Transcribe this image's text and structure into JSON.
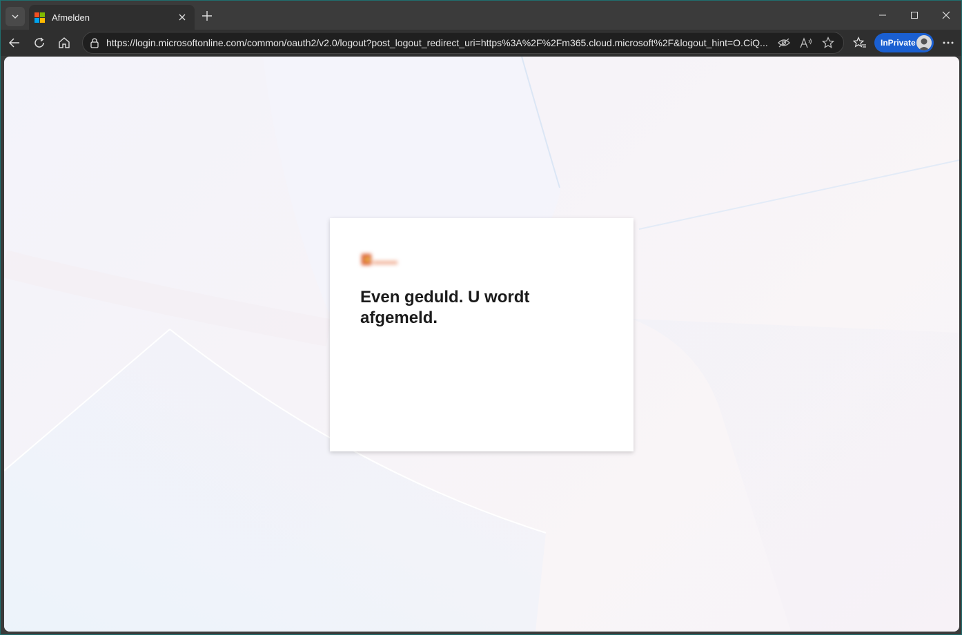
{
  "window": {
    "tab": {
      "title": "Afmelden"
    },
    "controls": [
      "minimize",
      "maximize",
      "close"
    ]
  },
  "toolbar": {
    "url": "https://login.microsoftonline.com/common/oauth2/v2.0/logout?post_logout_redirect_uri=https%3A%2F%2Fm365.cloud.microsoft%2F&logout_hint=O.CiQ...",
    "inprivate_label": "InPrivate"
  },
  "page": {
    "message": "Even geduld. U wordt afgemeld."
  },
  "colors": {
    "ms_red": "#f25022",
    "ms_green": "#7fba00",
    "ms_blue": "#00a4ef",
    "ms_yellow": "#ffb900",
    "inprivate_blue": "#1a5fd1"
  }
}
